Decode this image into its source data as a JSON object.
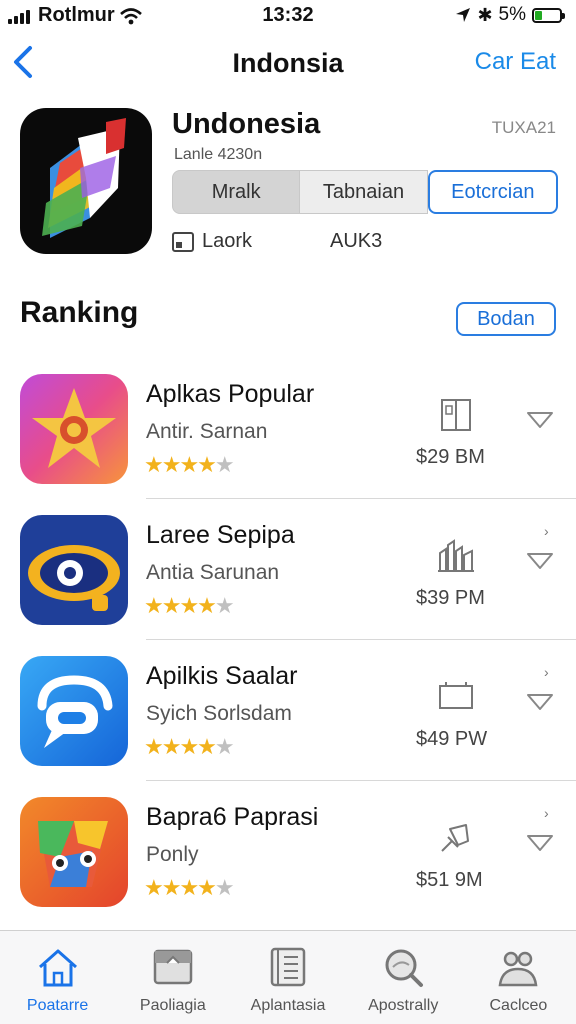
{
  "status": {
    "carrier": "Rotlmur",
    "time": "13:32",
    "battery": "5%"
  },
  "nav": {
    "back_icon": "chevron-left-icon",
    "title": "Indonsia",
    "action": "Car Eat"
  },
  "app": {
    "name": "Undonesia",
    "subtitle": "Lanle 4230n",
    "code": "TUXA21",
    "segments": [
      "Mralk",
      "Tabnaian",
      "Eotcrcian"
    ],
    "active_segment": 2,
    "meta_label": "Laork",
    "meta_value": "AUK3"
  },
  "section": {
    "title": "Ranking",
    "button": "Bodan"
  },
  "ranking": [
    {
      "name": "Aplkas Popular",
      "sub": "Antir. Sarnan",
      "price": "$29 BM",
      "rating": 4.5,
      "glyph": "book-icon",
      "icon": "star-app-icon"
    },
    {
      "name": "Laree Sepipa",
      "sub": "Antia Sarunan",
      "price": "$39 PM",
      "rating": 4.5,
      "glyph": "buildings-icon",
      "icon": "eye-app-icon"
    },
    {
      "name": "Apilkis Saalar",
      "sub": "Syich Sorlsdam",
      "price": "$49 PW",
      "rating": 4.5,
      "glyph": "monitor-icon",
      "icon": "chat-app-icon"
    },
    {
      "name": "Bapra6 Paprasi",
      "sub": "Ponly",
      "price": "$51 9M",
      "rating": 4,
      "glyph": "pin-icon",
      "icon": "cube-app-icon"
    }
  ],
  "tabs": [
    {
      "label": "Poatarre",
      "icon": "home-icon",
      "active": true
    },
    {
      "label": "Paoliagia",
      "icon": "photo-icon",
      "active": false
    },
    {
      "label": "Aplantasia",
      "icon": "list-icon",
      "active": false
    },
    {
      "label": "Apostrally",
      "icon": "search-icon",
      "active": false
    },
    {
      "label": "Caclceo",
      "icon": "people-icon",
      "active": false
    }
  ],
  "colors": {
    "accent": "#1a73e8",
    "star": "#f2b21c"
  }
}
